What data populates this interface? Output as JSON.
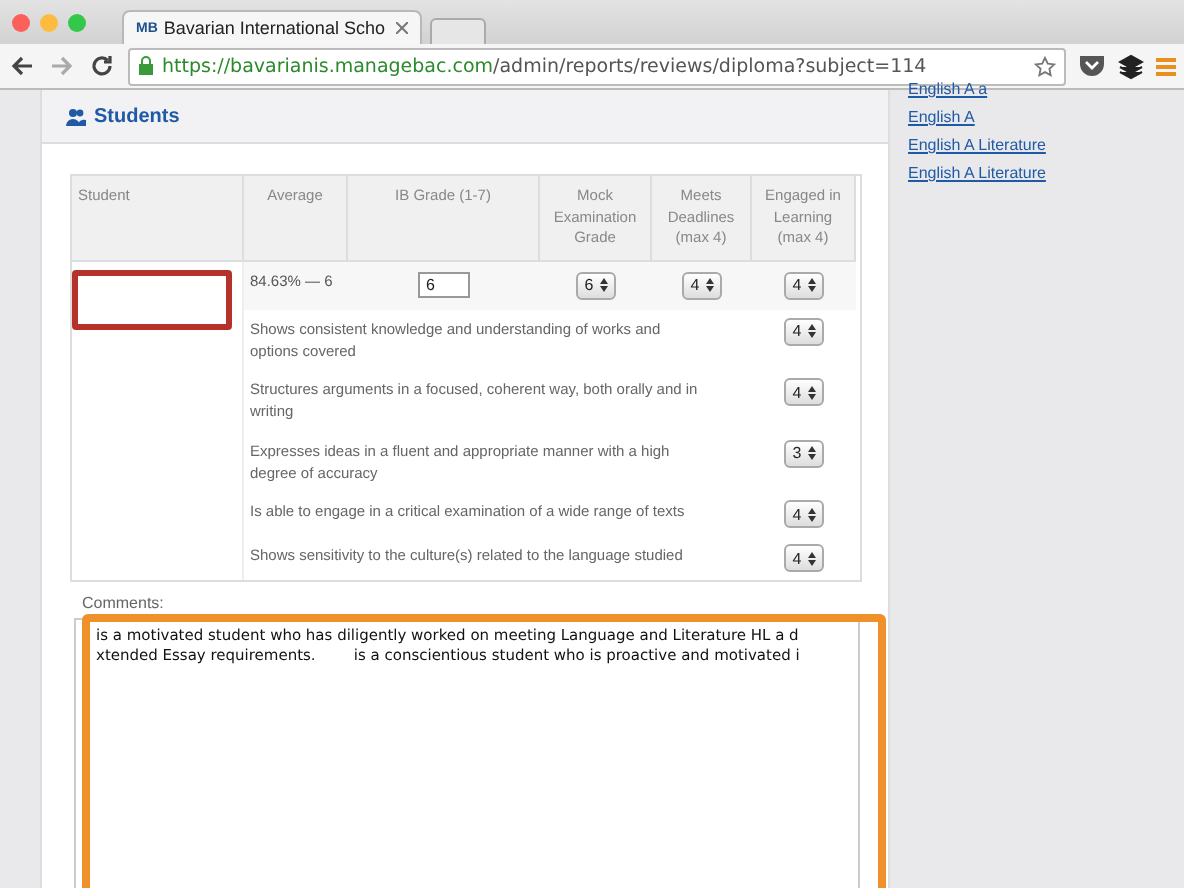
{
  "browser": {
    "tab_title": "Bavarian International Scho",
    "tab_logo": "MB",
    "url_host": "https://bavarianis.managebac.com",
    "url_path": "/admin/reports/reviews/diploma?subject=114"
  },
  "section": {
    "title": "Students"
  },
  "table": {
    "columns": [
      "Student",
      "Average",
      "IB Grade (1-7)",
      "Mock Examination Grade",
      "Meets Deadlines (max 4)",
      "Engaged in Learning (max 4)"
    ],
    "student": {
      "average": "84.63% — 6",
      "ib_grade": "6",
      "mock": "6",
      "deadlines": "4",
      "engaged": "4"
    },
    "criteria": [
      {
        "text": "Shows consistent knowledge and understanding of works and options covered",
        "value": "4"
      },
      {
        "text": "Structures arguments in a focused, coherent way, both orally and in writing",
        "value": "4"
      },
      {
        "text": "Expresses ideas in a fluent and appropriate manner with a high degree of accuracy",
        "value": "3"
      },
      {
        "text": "Is able to engage in a critical examination of a wide range of texts",
        "value": "4"
      },
      {
        "text": "Shows sensitivity to the culture(s) related to the language studied",
        "value": "4"
      }
    ]
  },
  "comments": {
    "label": "Comments:",
    "lines": [
      "is a motivated student who has diligently worked on meeting Language and Literature HL a d",
      "xtended Essay requirements.        is a conscientious student who is proactive and motivated i"
    ]
  },
  "sidebar": {
    "links": [
      "English A a",
      "English A",
      "English A Literature",
      "English A Literature"
    ]
  }
}
